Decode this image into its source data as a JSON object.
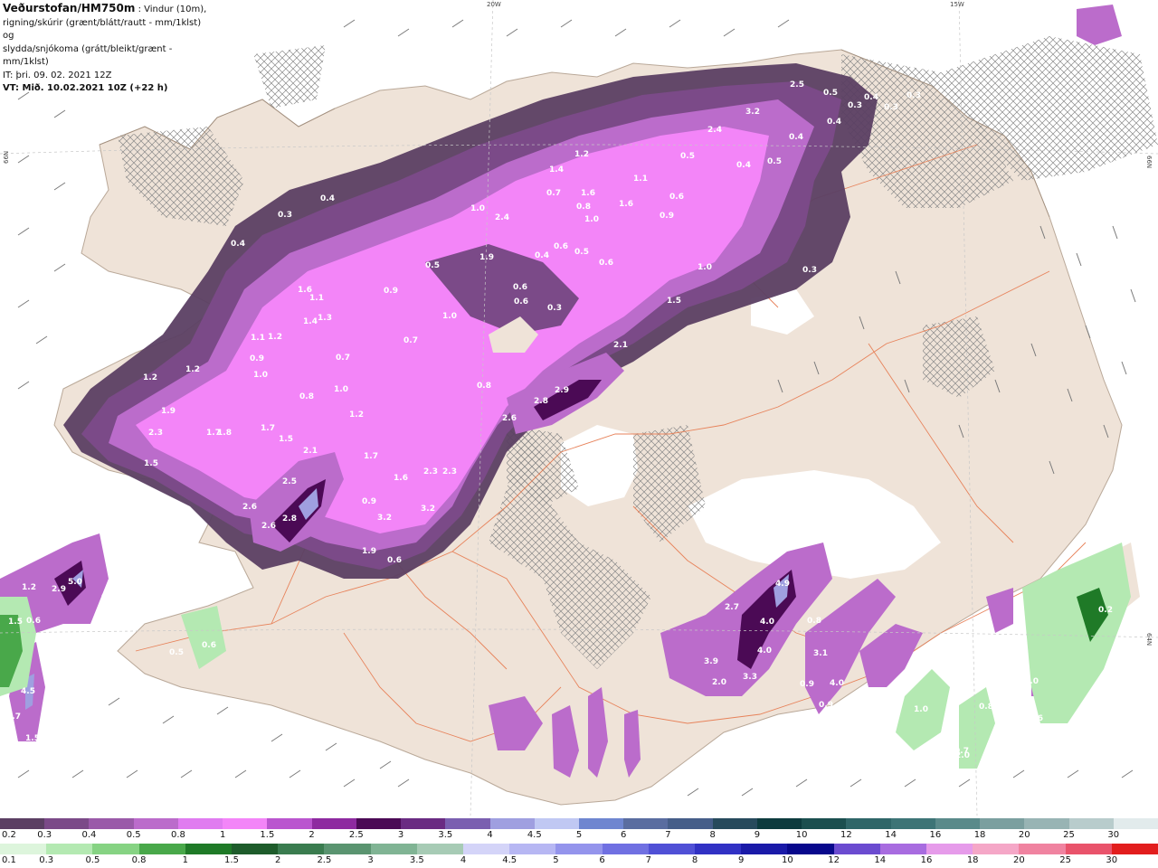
{
  "header": {
    "brand": "Veðurstofan/HM750m",
    "desc_1": " : Vindur (10m),",
    "desc_2": "rigning/skúrir (grænt/blátt/rautt - mm/1klst) og",
    "desc_3": "slydda/snjókoma (grátt/bleikt/grænt - mm/1klst)",
    "it_line": "IT: þri. 09. 02. 2021 12Z",
    "vt_line": "VT: Mið. 10.02.2021 10Z (+22 h)"
  },
  "map": {
    "grid_labels": [
      {
        "id": "lon-20w",
        "text": "20W"
      },
      {
        "id": "lon-15w",
        "text": "15W"
      },
      {
        "id": "lat-66n-left",
        "text": "66N"
      },
      {
        "id": "lat-66n-right",
        "text": "66N"
      },
      {
        "id": "lat-64n-right",
        "text": "64N"
      }
    ],
    "precip_values": [
      "0.5",
      "0.3",
      "0.4",
      "0.3",
      "0.3",
      "0.4",
      "0.4",
      "0.5",
      "0.4",
      "0.3",
      "2.5",
      "3.2",
      "2.4",
      "0.3",
      "0.4",
      "0.4",
      "1.2",
      "1.4",
      "0.7",
      "1.0",
      "1.6",
      "1.1",
      "0.8",
      "0.6",
      "1.6",
      "0.6",
      "1.0",
      "1.9",
      "2.4",
      "0.5",
      "0.6",
      "0.9",
      "0.4",
      "0.6",
      "0.5",
      "0.6",
      "1.0",
      "0.3",
      "1.5",
      "1.6",
      "1.1",
      "1.4",
      "1.3",
      "1.1",
      "1.2",
      "0.9",
      "1.0",
      "0.5",
      "0.9",
      "1.0",
      "0.7",
      "1.2",
      "1.2",
      "1.9",
      "2.3",
      "1.8",
      "1.7",
      "1.5",
      "2.1",
      "1.7",
      "1.6",
      "2.3",
      "2.6",
      "2.8",
      "2.9",
      "2.1",
      "0.8",
      "1.0",
      "0.8",
      "0.7",
      "1.2",
      "1.5",
      "1.7",
      "0.5",
      "1.6",
      "2.5",
      "2.6",
      "2.8",
      "3.2",
      "2.6",
      "0.9",
      "3.2",
      "2.3",
      "1.9",
      "0.6",
      "2.9",
      "5.0",
      "1.2",
      "4.0",
      "1.5",
      "0.6",
      "0.9",
      "1.0",
      "0.8",
      "0.5",
      "0.6",
      "4.5",
      "2.7",
      "1.5",
      "4.9",
      "2.7",
      "4.0",
      "0.8",
      "3.9",
      "4.0",
      "3.3",
      "2.0",
      "3.1",
      "4.0",
      "0.9",
      "0.9",
      "0.2",
      "0.6",
      "0.6",
      "1.0",
      "1.0",
      "0.8",
      "0.6",
      "0.7",
      "2.0",
      "0.5",
      "0.7"
    ]
  },
  "legend": {
    "snow_scale": [
      "0.2",
      "0.3",
      "0.4",
      "0.5",
      "0.8",
      "1",
      "1.5",
      "2",
      "2.5",
      "3",
      "3.5",
      "4",
      "4.5",
      "5",
      "6",
      "7",
      "8",
      "9",
      "10",
      "12",
      "14",
      "16",
      "18",
      "20",
      "25",
      "30"
    ],
    "snow_colors": [
      "#5b3f63",
      "#7b4a88",
      "#9a5aa9",
      "#bb6ccb",
      "#e07cf0",
      "#f385f8",
      "#ba55cf",
      "#8e2aa0",
      "#4b0a55",
      "#6a2b82",
      "#7a5fb0",
      "#9f9fe0",
      "#c0c8f3",
      "#6f86d0",
      "#5a6da0",
      "#465e89",
      "#274a5c",
      "#0d3b3e",
      "#1b4f4f",
      "#2f6668",
      "#3d7476",
      "#5a8a8a",
      "#7b9f9f",
      "#98b4b4",
      "#b8cccc",
      "#e2ebec"
    ],
    "rain_scale": [
      "0.1",
      "0.3",
      "0.5",
      "0.8",
      "1",
      "1.5",
      "2",
      "2.5",
      "3",
      "3.5",
      "4",
      "4.5",
      "5",
      "6",
      "7",
      "8",
      "9",
      "10",
      "12",
      "14",
      "16",
      "18",
      "20",
      "25",
      "30"
    ],
    "rain_colors": [
      "#ddf5dc",
      "#b4e9b2",
      "#86d383",
      "#49a84a",
      "#1f7a27",
      "#1e5c2b",
      "#3a7c4f",
      "#5a9470",
      "#80b494",
      "#a7cbb5",
      "#d4d4f8",
      "#b7b7f3",
      "#9494ec",
      "#7070e2",
      "#5050d6",
      "#3131c4",
      "#1a1aa8",
      "#08088c",
      "#6b4bd0",
      "#a86ce0",
      "#e69bea",
      "#f5a7c7",
      "#f083a0",
      "#e9536b",
      "#e21d1d"
    ]
  }
}
